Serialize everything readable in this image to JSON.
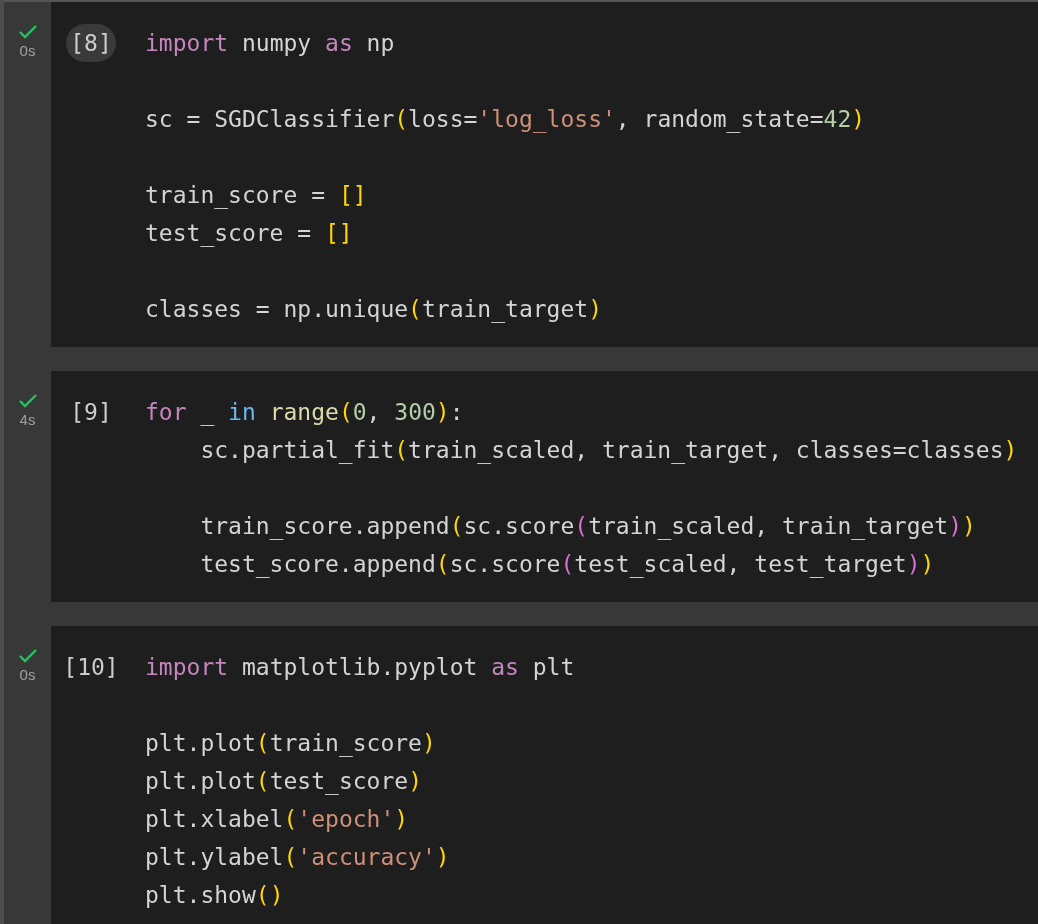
{
  "cells": [
    {
      "succeeded": true,
      "time": "0s",
      "count": "[8]",
      "hovered": true,
      "lines": [
        {
          "gap_before": false,
          "tokens": [
            {
              "kind": "keyword",
              "text": "import"
            },
            {
              "kind": "plain",
              "text": " numpy "
            },
            {
              "kind": "keyword",
              "text": "as"
            },
            {
              "kind": "plain",
              "text": " np"
            }
          ]
        },
        {
          "gap_before": true,
          "tokens": [
            {
              "kind": "plain",
              "text": "sc = SGDClassifier"
            },
            {
              "kind": "bracket",
              "text": "("
            },
            {
              "kind": "plain",
              "text": "loss="
            },
            {
              "kind": "string",
              "text": "'log_loss'"
            },
            {
              "kind": "plain",
              "text": ", random_state="
            },
            {
              "kind": "number",
              "text": "42"
            },
            {
              "kind": "bracket",
              "text": ")"
            }
          ]
        },
        {
          "gap_before": true,
          "tokens": [
            {
              "kind": "plain",
              "text": "train_score = "
            },
            {
              "kind": "bracket",
              "text": "[]"
            }
          ]
        },
        {
          "gap_before": false,
          "tokens": [
            {
              "kind": "plain",
              "text": "test_score = "
            },
            {
              "kind": "bracket",
              "text": "[]"
            }
          ]
        },
        {
          "gap_before": true,
          "tokens": [
            {
              "kind": "plain",
              "text": "classes = np.unique"
            },
            {
              "kind": "bracket",
              "text": "("
            },
            {
              "kind": "plain",
              "text": "train_target"
            },
            {
              "kind": "bracket",
              "text": ")"
            }
          ]
        }
      ]
    },
    {
      "succeeded": true,
      "time": "4s",
      "count": "[9]",
      "hovered": false,
      "lines": [
        {
          "gap_before": false,
          "tokens": [
            {
              "kind": "keyword",
              "text": "for"
            },
            {
              "kind": "plain",
              "text": " _ "
            },
            {
              "kind": "operator",
              "text": "in"
            },
            {
              "kind": "function",
              "text": " range"
            },
            {
              "kind": "bracket",
              "text": "("
            },
            {
              "kind": "number",
              "text": "0"
            },
            {
              "kind": "plain",
              "text": ", "
            },
            {
              "kind": "number",
              "text": "300"
            },
            {
              "kind": "bracket",
              "text": ")"
            },
            {
              "kind": "plain",
              "text": ":"
            }
          ]
        },
        {
          "gap_before": false,
          "tokens": [
            {
              "kind": "plain",
              "text": "    sc.partial_fit"
            },
            {
              "kind": "bracket",
              "text": "("
            },
            {
              "kind": "plain",
              "text": "train_scaled, train_target, classes=classes"
            },
            {
              "kind": "bracket",
              "text": ")"
            }
          ]
        },
        {
          "gap_before": true,
          "tokens": [
            {
              "kind": "plain",
              "text": "    train_score.append"
            },
            {
              "kind": "bracket",
              "text": "("
            },
            {
              "kind": "plain",
              "text": "sc.score"
            },
            {
              "kind": "bracket2",
              "text": "("
            },
            {
              "kind": "plain",
              "text": "train_scaled, train_target"
            },
            {
              "kind": "bracket2",
              "text": ")"
            },
            {
              "kind": "bracket",
              "text": ")"
            }
          ]
        },
        {
          "gap_before": false,
          "tokens": [
            {
              "kind": "plain",
              "text": "    test_score.append"
            },
            {
              "kind": "bracket",
              "text": "("
            },
            {
              "kind": "plain",
              "text": "sc.score"
            },
            {
              "kind": "bracket2",
              "text": "("
            },
            {
              "kind": "plain",
              "text": "test_scaled, test_target"
            },
            {
              "kind": "bracket2",
              "text": ")"
            },
            {
              "kind": "bracket",
              "text": ")"
            }
          ]
        }
      ]
    },
    {
      "succeeded": true,
      "time": "0s",
      "count": "[10]",
      "hovered": false,
      "lines": [
        {
          "gap_before": false,
          "tokens": [
            {
              "kind": "keyword",
              "text": "import"
            },
            {
              "kind": "plain",
              "text": " matplotlib.pyplot "
            },
            {
              "kind": "keyword",
              "text": "as"
            },
            {
              "kind": "plain",
              "text": " plt"
            }
          ]
        },
        {
          "gap_before": true,
          "tokens": [
            {
              "kind": "plain",
              "text": "plt.plot"
            },
            {
              "kind": "bracket",
              "text": "("
            },
            {
              "kind": "plain",
              "text": "train_score"
            },
            {
              "kind": "bracket",
              "text": ")"
            }
          ]
        },
        {
          "gap_before": false,
          "tokens": [
            {
              "kind": "plain",
              "text": "plt.plot"
            },
            {
              "kind": "bracket",
              "text": "("
            },
            {
              "kind": "plain",
              "text": "test_score"
            },
            {
              "kind": "bracket",
              "text": ")"
            }
          ]
        },
        {
          "gap_before": false,
          "tokens": [
            {
              "kind": "plain",
              "text": "plt.xlabel"
            },
            {
              "kind": "bracket",
              "text": "("
            },
            {
              "kind": "string",
              "text": "'epoch'"
            },
            {
              "kind": "bracket",
              "text": ")"
            }
          ]
        },
        {
          "gap_before": false,
          "tokens": [
            {
              "kind": "plain",
              "text": "plt.ylabel"
            },
            {
              "kind": "bracket",
              "text": "("
            },
            {
              "kind": "string",
              "text": "'accuracy'"
            },
            {
              "kind": "bracket",
              "text": ")"
            }
          ]
        },
        {
          "gap_before": false,
          "tokens": [
            {
              "kind": "plain",
              "text": "plt.show"
            },
            {
              "kind": "bracket",
              "text": "()"
            }
          ]
        }
      ]
    }
  ]
}
